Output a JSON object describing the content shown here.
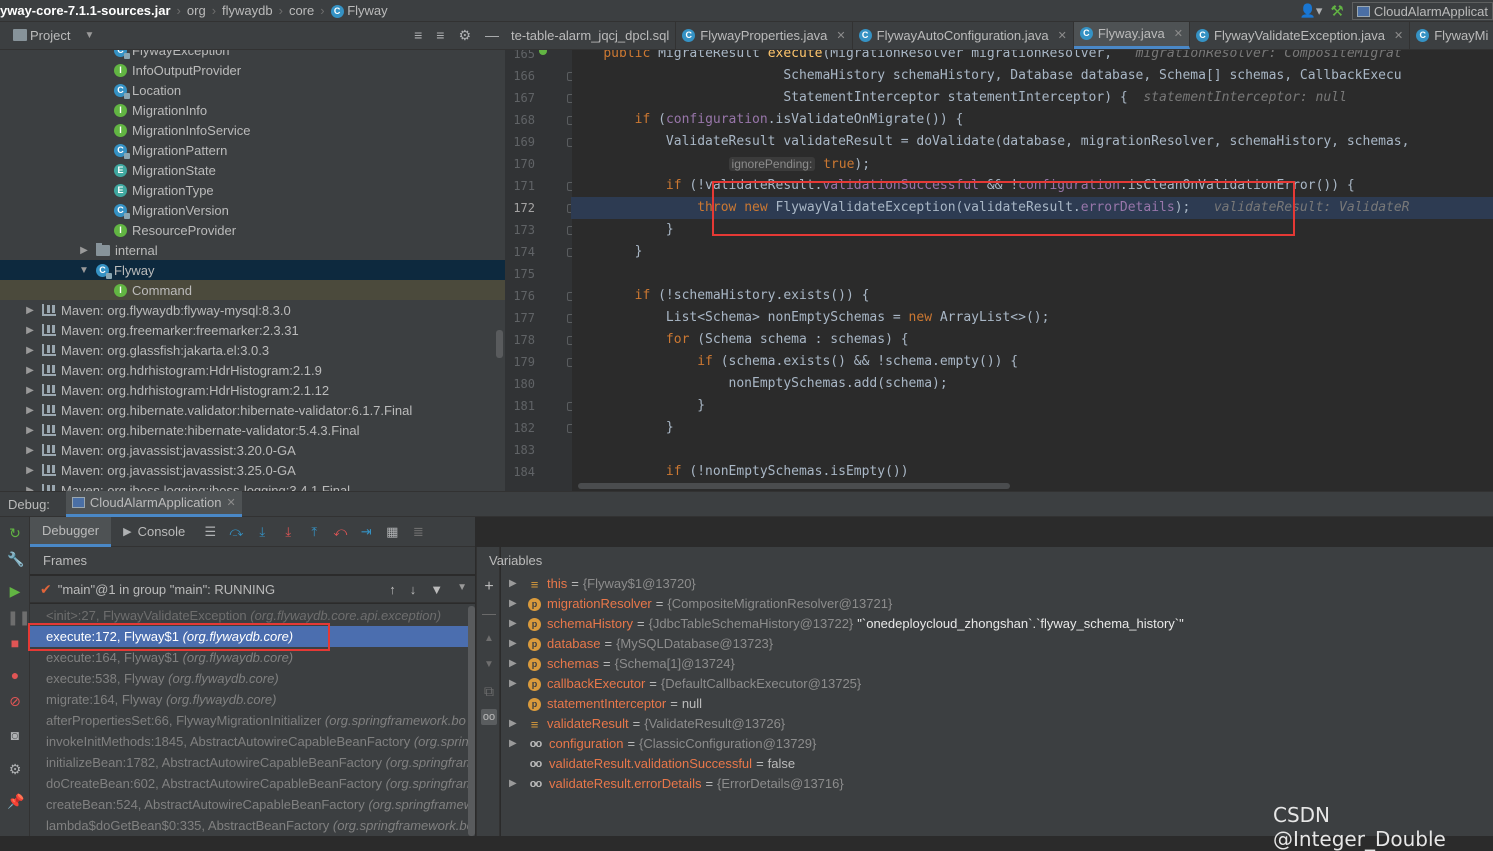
{
  "colors": {
    "accent": "#4a88c7",
    "selection": "#4b6eaf",
    "highlight_box": "#e53935",
    "keyword": "#cc7832",
    "method": "#ffc66d",
    "field": "#9876aa"
  },
  "navbar": {
    "crumbs": [
      "yway-core-7.1.1-sources.jar",
      "org",
      "flywaydb",
      "core",
      "Flyway"
    ],
    "run_config": "CloudAlarmApplicat"
  },
  "project": {
    "title": "Project",
    "tree": [
      {
        "label": "FlywayException",
        "icon": "class-lock-icon",
        "indent": 116,
        "arrow": ""
      },
      {
        "label": "InfoOutputProvider",
        "icon": "interface-icon",
        "indent": 116,
        "arrow": ""
      },
      {
        "label": "Location",
        "icon": "class-lock-icon",
        "indent": 116,
        "arrow": ""
      },
      {
        "label": "MigrationInfo",
        "icon": "interface-icon",
        "indent": 116,
        "arrow": ""
      },
      {
        "label": "MigrationInfoService",
        "icon": "interface-icon",
        "indent": 116,
        "arrow": ""
      },
      {
        "label": "MigrationPattern",
        "icon": "class-lock-icon",
        "indent": 116,
        "arrow": ""
      },
      {
        "label": "MigrationState",
        "icon": "enum-icon",
        "indent": 116,
        "arrow": ""
      },
      {
        "label": "MigrationType",
        "icon": "enum-icon",
        "indent": 116,
        "arrow": ""
      },
      {
        "label": "MigrationVersion",
        "icon": "class-lock-icon",
        "indent": 116,
        "arrow": ""
      },
      {
        "label": "ResourceProvider",
        "icon": "interface-icon",
        "indent": 116,
        "arrow": ""
      },
      {
        "label": "internal",
        "icon": "folder-icon",
        "indent": 98,
        "arrow": "›"
      },
      {
        "label": "Flyway",
        "icon": "class-lock-icon",
        "indent": 98,
        "arrow": "⌄"
      },
      {
        "label": "Command",
        "icon": "interface-icon",
        "indent": 116,
        "arrow": ""
      },
      {
        "label": "Maven: org.flywaydb:flyway-mysql:8.3.0",
        "icon": "library-icon",
        "indent": 44,
        "arrow": "›"
      },
      {
        "label": "Maven: org.freemarker:freemarker:2.3.31",
        "icon": "library-icon",
        "indent": 44,
        "arrow": "›"
      },
      {
        "label": "Maven: org.glassfish:jakarta.el:3.0.3",
        "icon": "library-icon",
        "indent": 44,
        "arrow": "›"
      },
      {
        "label": "Maven: org.hdrhistogram:HdrHistogram:2.1.9",
        "icon": "library-icon",
        "indent": 44,
        "arrow": "›"
      },
      {
        "label": "Maven: org.hdrhistogram:HdrHistogram:2.1.12",
        "icon": "library-icon",
        "indent": 44,
        "arrow": "›"
      },
      {
        "label": "Maven: org.hibernate.validator:hibernate-validator:6.1.7.Final",
        "icon": "library-icon",
        "indent": 44,
        "arrow": "›"
      },
      {
        "label": "Maven: org.hibernate:hibernate-validator:5.4.3.Final",
        "icon": "library-icon",
        "indent": 44,
        "arrow": "›"
      },
      {
        "label": "Maven: org.javassist:javassist:3.20.0-GA",
        "icon": "library-icon",
        "indent": 44,
        "arrow": "›"
      },
      {
        "label": "Maven: org.javassist:javassist:3.25.0-GA",
        "icon": "library-icon",
        "indent": 44,
        "arrow": "›"
      },
      {
        "label": "Maven: org.jboss.logging:jboss-logging:3.4.1.Final",
        "icon": "library-icon",
        "indent": 44,
        "arrow": "›"
      }
    ],
    "selected_index": 11,
    "highlight_index": 12
  },
  "editor": {
    "tabs": [
      {
        "label": "te-table-alarm_jqcj_dpcl.sql",
        "icon": "",
        "active": false,
        "close": false
      },
      {
        "label": "FlywayProperties.java",
        "icon": "class-icon",
        "active": false,
        "close": true
      },
      {
        "label": "FlywayAutoConfiguration.java",
        "icon": "class-icon",
        "active": false,
        "close": true
      },
      {
        "label": "Flyway.java",
        "icon": "class-icon",
        "active": true,
        "close": true
      },
      {
        "label": "FlywayValidateException.java",
        "icon": "class-icon",
        "active": false,
        "close": true
      },
      {
        "label": "FlywayMi",
        "icon": "class-icon",
        "active": false,
        "close": false
      }
    ],
    "line_numbers": [
      "165",
      "166",
      "167",
      "168",
      "169",
      "170",
      "171",
      "172",
      "173",
      "174",
      "175",
      "176",
      "177",
      "178",
      "179",
      "180",
      "181",
      "182",
      "183",
      "184"
    ],
    "current_line_index": 7,
    "lines": [
      [
        {
          "t": "    "
        },
        {
          "t": "public ",
          "c": "kw"
        },
        {
          "t": "MigrateResult "
        },
        {
          "t": "execute",
          "c": "fn"
        },
        {
          "t": "(MigrationResolver migrationResolver,   "
        },
        {
          "t": "migrationResolver: CompositeMigrat",
          "c": "hint"
        }
      ],
      [
        {
          "t": "                           SchemaHistory schemaHistory, Database database, Schema[] schemas, CallbackExecu"
        }
      ],
      [
        {
          "t": "                           StatementInterceptor statementInterceptor) {  "
        },
        {
          "t": "statementInterceptor: null",
          "c": "hint"
        }
      ],
      [
        {
          "t": "        "
        },
        {
          "t": "if ",
          "c": "kw"
        },
        {
          "t": "("
        },
        {
          "t": "configuration",
          "c": "fld"
        },
        {
          "t": ".isValidateOnMigrate()) {"
        }
      ],
      [
        {
          "t": "            ValidateResult validateResult = doValidate(database, migrationResolver, schemaHistory, schemas,"
        }
      ],
      [
        {
          "t": "                    "
        },
        {
          "t": "ignorePending:",
          "c": "inlay"
        },
        {
          "t": " "
        },
        {
          "t": "true",
          "c": "kw"
        },
        {
          "t": ");"
        }
      ],
      [
        {
          "t": "            "
        },
        {
          "t": "if ",
          "c": "kw"
        },
        {
          "t": "(!validateResult."
        },
        {
          "t": "validationSuccessful ",
          "c": "fld"
        },
        {
          "t": "&& !"
        },
        {
          "t": "configuration",
          "c": "fld"
        },
        {
          "t": ".isCleanOnValidationError()) {"
        }
      ],
      [
        {
          "t": "                "
        },
        {
          "t": "throw new ",
          "c": "kw"
        },
        {
          "t": "FlywayValidateException(validateResult."
        },
        {
          "t": "errorDetails",
          "c": "fld"
        },
        {
          "t": ");   "
        },
        {
          "t": "validateResult: ValidateR",
          "c": "hint"
        }
      ],
      [
        {
          "t": "            }"
        }
      ],
      [
        {
          "t": "        }"
        }
      ],
      [
        {
          "t": ""
        }
      ],
      [
        {
          "t": "        "
        },
        {
          "t": "if ",
          "c": "kw"
        },
        {
          "t": "(!schemaHistory.exists()) {"
        }
      ],
      [
        {
          "t": "            List<Schema> nonEmptySchemas = "
        },
        {
          "t": "new ",
          "c": "kw"
        },
        {
          "t": "ArrayList<>();"
        }
      ],
      [
        {
          "t": "            "
        },
        {
          "t": "for ",
          "c": "kw"
        },
        {
          "t": "(Schema schema : schemas) {"
        }
      ],
      [
        {
          "t": "                "
        },
        {
          "t": "if ",
          "c": "kw"
        },
        {
          "t": "(schema.exists() && !schema.empty()) {"
        }
      ],
      [
        {
          "t": "                    nonEmptySchemas.add(schema);"
        }
      ],
      [
        {
          "t": "                }"
        }
      ],
      [
        {
          "t": "            }"
        }
      ],
      [
        {
          "t": ""
        }
      ],
      [
        {
          "t": "            "
        },
        {
          "t": "if ",
          "c": "kw"
        },
        {
          "t": "(!nonEmptySchemas.isEmpty())"
        }
      ]
    ]
  },
  "debug": {
    "label": "Debug:",
    "session_tab": "CloudAlarmApplication",
    "debugger_tab": "Debugger",
    "console_tab": "Console",
    "frames_title": "Frames",
    "thread": "\"main\"@1 in group \"main\": RUNNING",
    "frames": [
      {
        "method": "<init>:27, FlywayValidateException",
        "pkg": "(org.flywaydb.core.api.exception)"
      },
      {
        "method": "execute:172, Flyway$1",
        "pkg": "(org.flywaydb.core)"
      },
      {
        "method": "execute:164, Flyway$1",
        "pkg": "(org.flywaydb.core)"
      },
      {
        "method": "execute:538, Flyway",
        "pkg": "(org.flywaydb.core)"
      },
      {
        "method": "migrate:164, Flyway",
        "pkg": "(org.flywaydb.core)"
      },
      {
        "method": "afterPropertiesSet:66, FlywayMigrationInitializer",
        "pkg": "(org.springframework.bo"
      },
      {
        "method": "invokeInitMethods:1845, AbstractAutowireCapableBeanFactory",
        "pkg": "(org.spring"
      },
      {
        "method": "initializeBean:1782, AbstractAutowireCapableBeanFactory",
        "pkg": "(org.springfram"
      },
      {
        "method": "doCreateBean:602, AbstractAutowireCapableBeanFactory",
        "pkg": "(org.springfram"
      },
      {
        "method": "createBean:524, AbstractAutowireCapableBeanFactory",
        "pkg": "(org.springframew"
      },
      {
        "method": "lambda$doGetBean$0:335, AbstractBeanFactory",
        "pkg": "(org.springframework.be"
      }
    ],
    "selected_frame": 1,
    "variables_title": "Variables",
    "variables": [
      {
        "icon": "field-list-icon",
        "name": "this",
        "value": "{Flyway$1@13720}",
        "extra": "",
        "plain": false,
        "arrow": true
      },
      {
        "icon": "parameter-icon",
        "name": "migrationResolver",
        "value": "{CompositeMigrationResolver@13721}",
        "extra": "",
        "plain": false,
        "arrow": true
      },
      {
        "icon": "parameter-icon",
        "name": "schemaHistory",
        "value": "{JdbcTableSchemaHistory@13722}",
        "extra": "\"`onedeploycloud_zhongshan`.`flyway_schema_history`\"",
        "plain": false,
        "arrow": true
      },
      {
        "icon": "parameter-icon",
        "name": "database",
        "value": "{MySQLDatabase@13723}",
        "extra": "",
        "plain": false,
        "arrow": true
      },
      {
        "icon": "parameter-icon",
        "name": "schemas",
        "value": "{Schema[1]@13724}",
        "extra": "",
        "plain": false,
        "arrow": true
      },
      {
        "icon": "parameter-icon",
        "name": "callbackExecutor",
        "value": "{DefaultCallbackExecutor@13725}",
        "extra": "",
        "plain": false,
        "arrow": true
      },
      {
        "icon": "parameter-icon",
        "name": "statementInterceptor",
        "value": "null",
        "extra": "",
        "plain": true,
        "arrow": false
      },
      {
        "icon": "field-list-icon",
        "name": "validateResult",
        "value": "{ValidateResult@13726}",
        "extra": "",
        "plain": false,
        "arrow": true
      },
      {
        "icon": "watch-icon",
        "name": "configuration",
        "value": "{ClassicConfiguration@13729}",
        "extra": "",
        "plain": false,
        "arrow": true
      },
      {
        "icon": "watch-icon",
        "name": "validateResult.validationSuccessful",
        "value": "false",
        "extra": "",
        "plain": true,
        "arrow": false
      },
      {
        "icon": "watch-icon",
        "name": "validateResult.errorDetails",
        "value": "{ErrorDetails@13716}",
        "extra": "",
        "plain": false,
        "arrow": true
      }
    ]
  },
  "watermark": "CSDN @Integer_Double"
}
